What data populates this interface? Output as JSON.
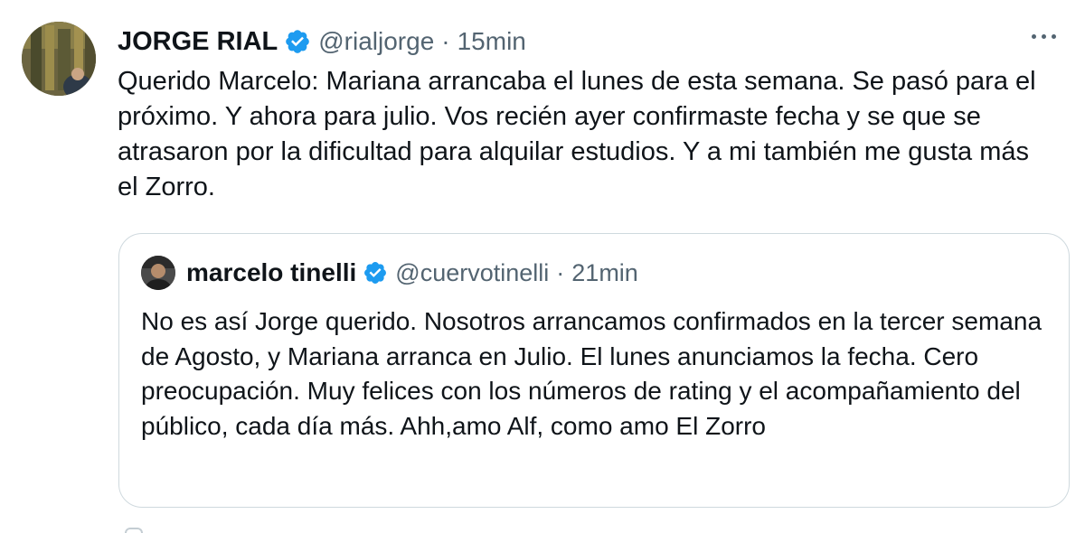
{
  "tweet": {
    "author_name": "JORGE RIAL",
    "handle": "@rialjorge",
    "separator": "·",
    "time": "15min",
    "text": "Querido Marcelo: Mariana arrancaba el lunes de esta semana. Se pasó para el próximo. Y ahora para julio. Vos recién ayer confirmaste fecha y se que se atrasaron por la dificultad para alquilar estudios. Y a mi también me gusta más el Zorro.",
    "icons": {
      "verified": "verified-badge-icon",
      "more": "more-options-icon"
    }
  },
  "quoted_tweet": {
    "author_name": "marcelo tinelli",
    "handle": "@cuervotinelli",
    "separator": "·",
    "time": "21min",
    "text": "No es así Jorge querido. Nosotros arrancamos confirmados en la tercer semana de Agosto, y Mariana arranca en Julio. El lunes anunciamos la fecha. Cero preocupación. Muy felices con los números de rating y el acompañamiento del público, cada día más. Ahh,amo Alf, como amo El Zorro"
  },
  "colors": {
    "text_primary": "#0f1419",
    "text_secondary": "#536471",
    "verified_blue": "#1d9bf0",
    "border": "#cfd9de",
    "background": "#ffffff"
  }
}
